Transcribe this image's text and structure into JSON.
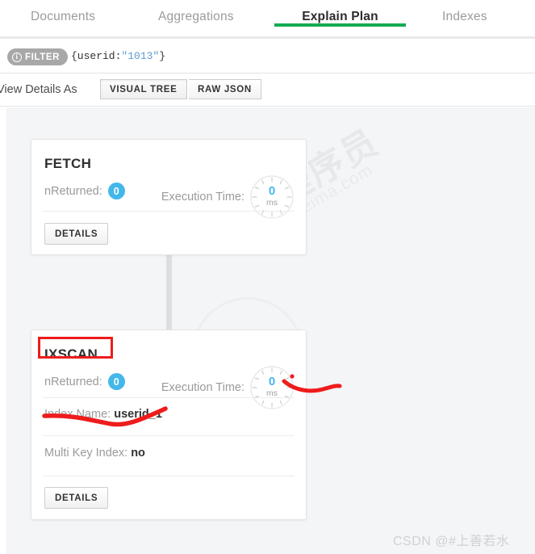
{
  "tabs": [
    {
      "label": "Documents",
      "active": false
    },
    {
      "label": "Aggregations",
      "active": false
    },
    {
      "label": "Explain Plan",
      "active": true
    },
    {
      "label": "Indexes",
      "active": false
    }
  ],
  "filter_bar": {
    "badge_label": "FILTER",
    "badge_icon": "info-icon",
    "query_prefix": "{userid:",
    "query_value": "\"1013\"",
    "query_suffix": "}"
  },
  "view_toolbar": {
    "label": "View Details As",
    "options": [
      {
        "label": "VISUAL TREE",
        "active": true
      },
      {
        "label": "RAW JSON",
        "active": false
      }
    ]
  },
  "plan": {
    "nodes": [
      {
        "title": "FETCH",
        "nreturned_label": "nReturned:",
        "nreturned_value": "0",
        "exec_label": "Execution Time:",
        "exec_value": "0",
        "exec_unit": "ms",
        "details_button": "DETAILS",
        "rows": []
      },
      {
        "title": "IXSCAN",
        "nreturned_label": "nReturned:",
        "nreturned_value": "0",
        "exec_label": "Execution Time:",
        "exec_value": "0",
        "exec_unit": "ms",
        "details_button": "DETAILS",
        "rows": [
          {
            "label": "Index Name:",
            "value": "userid_1"
          },
          {
            "label": "Multi Key Index:",
            "value": "no"
          }
        ]
      }
    ]
  },
  "watermarks": {
    "diagonal_main": "黑马程序员",
    "diagonal_sub": "www.itheima.com",
    "csdn": "CSDN @#上善若水"
  },
  "colors": {
    "accent_green": "#13aa52",
    "badge_blue": "#43b7ea",
    "annotation_red": "#ee1c1c",
    "canvas_bg": "#f4f5f7"
  }
}
